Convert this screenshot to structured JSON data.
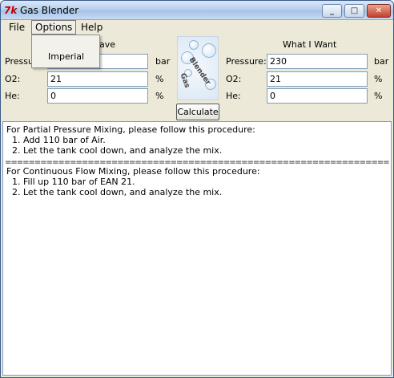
{
  "window": {
    "title": "Gas Blender",
    "app_icon": "tk-feather-icon",
    "controls": {
      "minimize": "_",
      "maximize": "□",
      "close": "✕"
    }
  },
  "menubar": {
    "items": [
      {
        "label": "File"
      },
      {
        "label": "Options"
      },
      {
        "label": "Help"
      }
    ]
  },
  "options_menu": {
    "items": [
      {
        "label": "Imperial"
      }
    ]
  },
  "have": {
    "heading": "ave",
    "pressure_label": "Pressu",
    "pressure_value": "",
    "pressure_unit": "bar",
    "o2_label": "O2:",
    "o2_value": "21",
    "o2_unit": "%",
    "he_label": "He:",
    "he_value": "0",
    "he_unit": "%"
  },
  "want": {
    "heading": "What I Want",
    "pressure_label": "Pressure:",
    "pressure_value": "230",
    "pressure_unit": "bar",
    "o2_label": "O2:",
    "o2_value": "21",
    "o2_unit": "%",
    "he_label": "He:",
    "he_value": "0",
    "he_unit": "%"
  },
  "logo": {
    "text": "Blender",
    "text2": "Gas"
  },
  "calculate_label": "Calculate",
  "output": {
    "partial": [
      "For Partial Pressure Mixing, please follow this procedure:",
      "  1. Add 110 bar of Air.",
      "  2. Let the tank cool down, and analyze the mix."
    ],
    "separator": "=========================================================================================",
    "continuous": [
      "For Continuous Flow Mixing, please follow this procedure:",
      "  1. Fill up 110 bar of EAN 21.",
      "  2. Let the tank cool down, and analyze the mix."
    ]
  }
}
